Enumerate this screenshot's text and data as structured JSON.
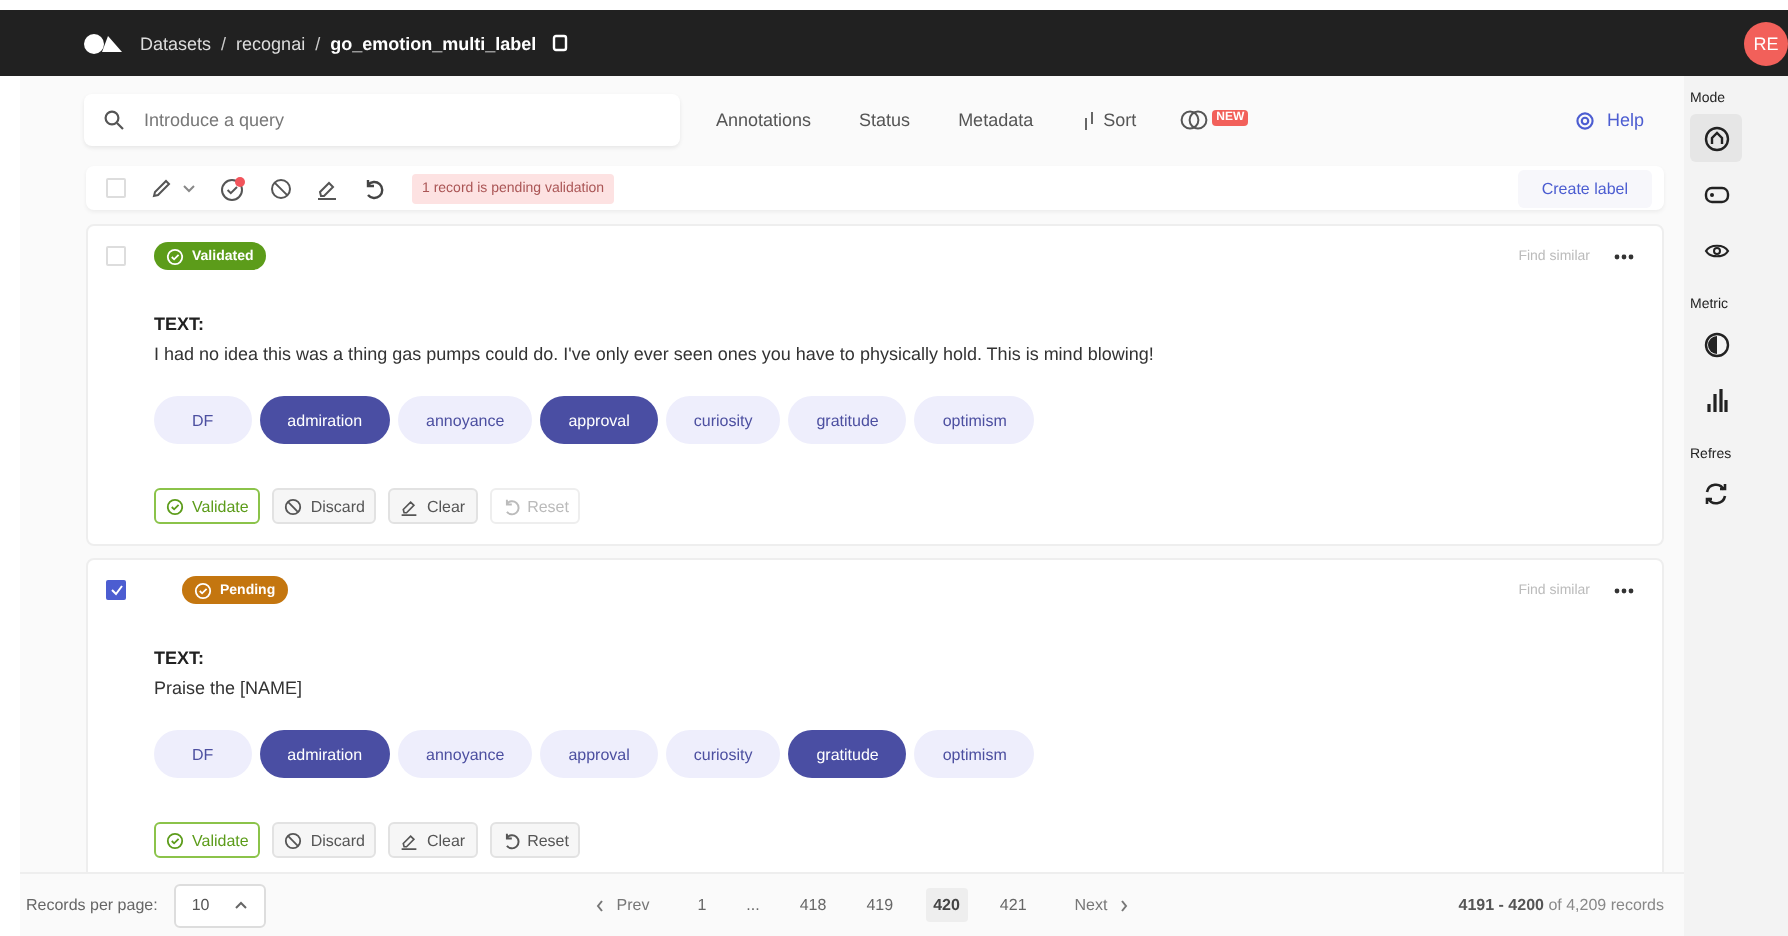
{
  "header": {
    "breadcrumbs": [
      "Datasets",
      "recognai",
      "go_emotion_multi_label"
    ],
    "separators": [
      "/",
      "/"
    ],
    "avatar": "RE"
  },
  "toolbar": {
    "search_placeholder": "Introduce a query",
    "filters": [
      "Annotations",
      "Status",
      "Metadata"
    ],
    "sort": "Sort",
    "new_badge": "NEW",
    "help": "Help"
  },
  "bulk_bar": {
    "checked": false,
    "pending_note": "1 record is pending validation",
    "create_label": "Create label"
  },
  "records": [
    {
      "checked": false,
      "status": {
        "kind": "validated",
        "label": "Validated"
      },
      "find_similar": "Find similar",
      "field_label": "TEXT:",
      "text": "I had no idea this was a thing gas pumps could do. I've only ever seen ones you have to physically hold. This is mind blowing!",
      "labels": [
        {
          "label": "DF",
          "selected": false
        },
        {
          "label": "admiration",
          "selected": true
        },
        {
          "label": "annoyance",
          "selected": false
        },
        {
          "label": "approval",
          "selected": true
        },
        {
          "label": "curiosity",
          "selected": false
        },
        {
          "label": "gratitude",
          "selected": false
        },
        {
          "label": "optimism",
          "selected": false
        }
      ],
      "actions": [
        {
          "kind": "validate",
          "label": "Validate",
          "disabled": false
        },
        {
          "kind": "discard",
          "label": "Discard",
          "disabled": false
        },
        {
          "kind": "clear",
          "label": "Clear",
          "disabled": false
        },
        {
          "kind": "reset",
          "label": "Reset",
          "disabled": true
        }
      ]
    },
    {
      "checked": true,
      "status": {
        "kind": "pending",
        "label": "Pending"
      },
      "find_similar": "Find similar",
      "field_label": "TEXT:",
      "text": "Praise the [NAME]",
      "labels": [
        {
          "label": "DF",
          "selected": false
        },
        {
          "label": "admiration",
          "selected": true
        },
        {
          "label": "annoyance",
          "selected": false
        },
        {
          "label": "approval",
          "selected": false
        },
        {
          "label": "curiosity",
          "selected": false
        },
        {
          "label": "gratitude",
          "selected": true
        },
        {
          "label": "optimism",
          "selected": false
        }
      ],
      "actions": [
        {
          "kind": "validate",
          "label": "Validate",
          "disabled": false
        },
        {
          "kind": "discard",
          "label": "Discard",
          "disabled": false
        },
        {
          "kind": "clear",
          "label": "Clear",
          "disabled": false
        },
        {
          "kind": "reset",
          "label": "Reset",
          "disabled": false
        }
      ]
    }
  ],
  "footer": {
    "per_page_label": "Records per page:",
    "per_page": "10",
    "prev": "Prev",
    "pages": [
      {
        "label": "1",
        "selected": false
      },
      {
        "label": "...",
        "selected": false
      },
      {
        "label": "418",
        "selected": false
      },
      {
        "label": "419",
        "selected": false
      },
      {
        "label": "420",
        "selected": true
      },
      {
        "label": "421",
        "selected": false
      }
    ],
    "next": "Next",
    "range": "**4191 - 4200** of 4,209 records"
  },
  "sidebar": {
    "sections": [
      {
        "title": "Mode",
        "items": [
          {
            "kind": "explore",
            "selected": true
          },
          {
            "kind": "label",
            "selected": false
          },
          {
            "kind": "view",
            "selected": false
          }
        ]
      },
      {
        "title": "Metric",
        "items": [
          {
            "kind": "progress",
            "selected": false
          },
          {
            "kind": "stats",
            "selected": false
          }
        ]
      },
      {
        "title": "Refres",
        "items": [
          {
            "kind": "refresh",
            "selected": false
          }
        ]
      }
    ]
  }
}
